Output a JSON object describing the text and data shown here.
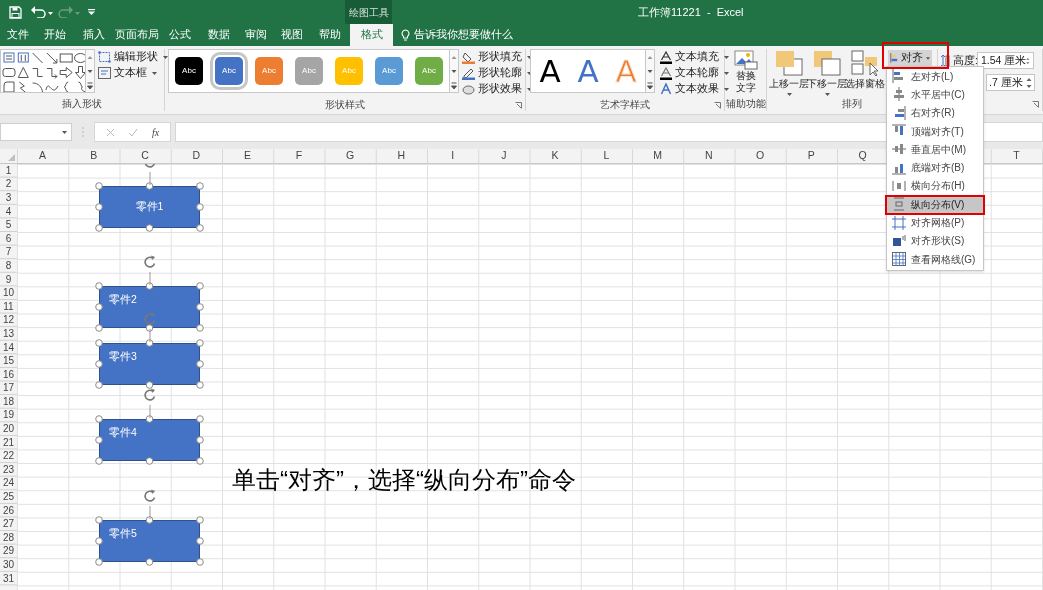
{
  "window": {
    "title": "工作簿11221  -  Excel",
    "context_tab": "绘图工具"
  },
  "tabs": [
    {
      "label": "文件",
      "selected": false
    },
    {
      "label": "开始",
      "selected": false
    },
    {
      "label": "插入",
      "selected": false
    },
    {
      "label": "页面布局",
      "selected": false
    },
    {
      "label": "公式",
      "selected": false
    },
    {
      "label": "数据",
      "selected": false
    },
    {
      "label": "审阅",
      "selected": false
    },
    {
      "label": "视图",
      "selected": false
    },
    {
      "label": "帮助",
      "selected": false
    },
    {
      "label": "格式",
      "selected": true
    }
  ],
  "tell_me": "告诉我你想要做什么",
  "insert_shapes": {
    "buttons": [
      "编辑形状",
      "文本框"
    ],
    "label": "插入形状"
  },
  "shape_styles": {
    "swatches": [
      {
        "text": "Abc",
        "color": "#000000",
        "selected": false
      },
      {
        "text": "Abc",
        "color": "#4472c4",
        "selected": true
      },
      {
        "text": "Abc",
        "color": "#ed7d31",
        "selected": false
      },
      {
        "text": "Abc",
        "color": "#a5a5a5",
        "selected": false
      },
      {
        "text": "Abc",
        "color": "#ffc000",
        "selected": false
      },
      {
        "text": "Abc",
        "color": "#5b9bd5",
        "selected": false
      },
      {
        "text": "Abc",
        "color": "#70ad47",
        "selected": false
      }
    ],
    "buttons": [
      "形状填充",
      "形状轮廓",
      "形状效果"
    ],
    "label": "形状样式"
  },
  "wordart": {
    "samples": [
      {
        "text": "A",
        "color": "#000000",
        "outline": false
      },
      {
        "text": "A",
        "color": "#4472c4",
        "outline": false
      },
      {
        "text": "A",
        "color": "#ed7d31",
        "outline": true
      }
    ],
    "buttons": [
      "文本填充",
      "文本轮廓",
      "文本效果"
    ],
    "label": "艺术字样式"
  },
  "accessibility": {
    "button": "替换文字",
    "label": "辅助功能"
  },
  "arrange": {
    "buttons": [
      {
        "text": "上移一层",
        "caret": true
      },
      {
        "text": "下移一层",
        "caret": true
      },
      {
        "text": "选择窗格",
        "caret": false
      }
    ],
    "align_button": "对齐",
    "label": "排列"
  },
  "size": {
    "height_label": "高度:",
    "height_value": "1.54 厘米",
    "width_value": ".7 厘米"
  },
  "formula_bar": {
    "function_label": "fx"
  },
  "sheet": {
    "columns": [
      "A",
      "B",
      "C",
      "D",
      "E",
      "F",
      "G",
      "H",
      "I",
      "J",
      "K",
      "L",
      "M",
      "N",
      "O",
      "P",
      "Q",
      "T"
    ],
    "rows": [
      "1",
      "2",
      "3",
      "4",
      "5",
      "6",
      "7",
      "8",
      "9",
      "10",
      "11",
      "12",
      "13",
      "14",
      "15",
      "16",
      "17",
      "18",
      "19",
      "20",
      "21",
      "22",
      "23",
      "24",
      "25",
      "26",
      "27",
      "28",
      "29",
      "30",
      "31"
    ],
    "shapes": [
      {
        "label": "零件1",
        "selected": true,
        "centered": true
      },
      {
        "label": "零件2",
        "selected": true,
        "centered": false
      },
      {
        "label": "零件3",
        "selected": true,
        "centered": false
      },
      {
        "label": "零件4",
        "selected": true,
        "centered": false
      },
      {
        "label": "零件5",
        "selected": true,
        "centered": false
      }
    ]
  },
  "align_menu": {
    "items": [
      {
        "label": "左对齐(L)",
        "selected": false
      },
      {
        "label": "水平居中(C)",
        "selected": false
      },
      {
        "label": "右对齐(R)",
        "selected": false
      },
      {
        "label": "顶端对齐(T)",
        "selected": false
      },
      {
        "label": "垂直居中(M)",
        "selected": false
      },
      {
        "label": "底端对齐(B)",
        "selected": false
      },
      {
        "label": "横向分布(H)",
        "selected": false
      },
      {
        "label": "纵向分布(V)",
        "selected": true
      },
      {
        "label": "对齐网格(P)",
        "selected": false
      },
      {
        "label": "对齐形状(S)",
        "selected": false
      },
      {
        "label": "查看网格线(G)",
        "selected": false
      }
    ]
  },
  "caption": "单击“对齐”，选择“纵向分布”命令"
}
